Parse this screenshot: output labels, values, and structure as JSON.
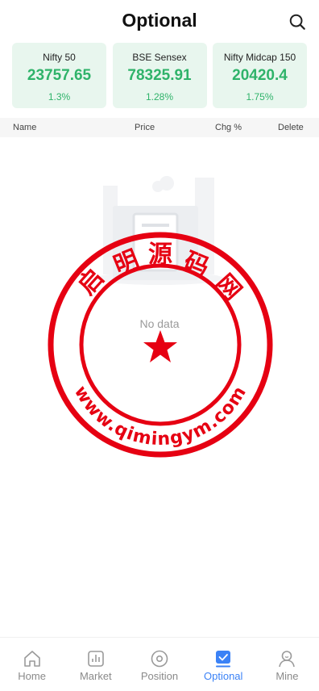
{
  "header": {
    "title": "Optional",
    "search_icon": "search-icon"
  },
  "indices": [
    {
      "name": "Nifty 50",
      "value": "23757.65",
      "change": "1.3%"
    },
    {
      "name": "BSE Sensex",
      "value": "78325.91",
      "change": "1.28%"
    },
    {
      "name": "Nifty Midcap 150",
      "value": "20420.4",
      "change": "1.75%"
    }
  ],
  "table": {
    "col_name": "Name",
    "col_price": "Price",
    "col_change": "Chg %",
    "col_delete": "Delete"
  },
  "empty": {
    "text": "No data"
  },
  "watermark": {
    "chars": [
      "启",
      "明",
      "源",
      "码",
      "网"
    ],
    "url": "www.qimingym.com",
    "color": "#e60012"
  },
  "colors": {
    "positive": "#2fb36a",
    "accent": "#3b82f6",
    "card_bg": "#e8f6ee"
  },
  "tabs": [
    {
      "label": "Home",
      "icon": "home-icon"
    },
    {
      "label": "Market",
      "icon": "market-icon"
    },
    {
      "label": "Position",
      "icon": "position-icon"
    },
    {
      "label": "Optional",
      "icon": "optional-icon",
      "active": true
    },
    {
      "label": "Mine",
      "icon": "profile-icon"
    }
  ]
}
